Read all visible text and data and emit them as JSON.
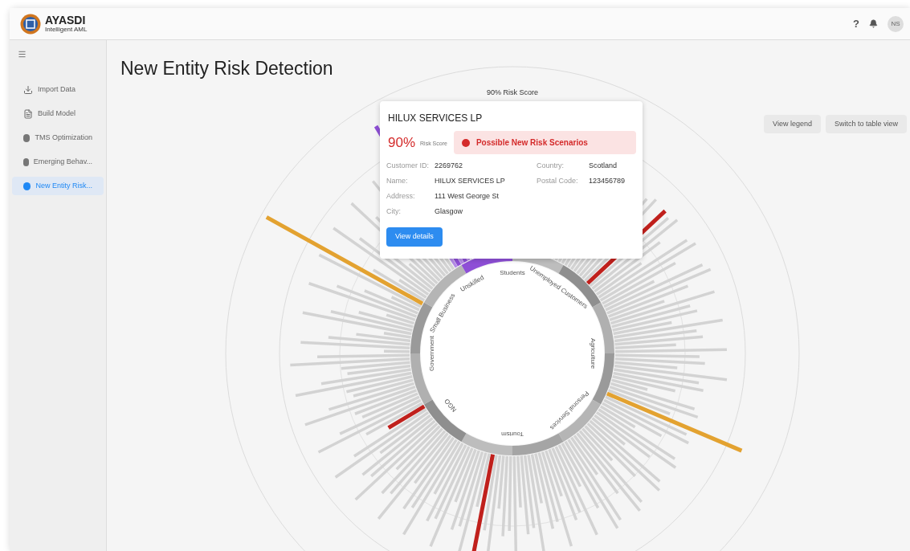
{
  "app": {
    "name": "AYASDI",
    "subtitle": "Intelligent AML"
  },
  "header": {
    "help": "?",
    "avatar": "NS"
  },
  "sidebar": {
    "items": [
      {
        "label": "Import Data",
        "kind": "download",
        "selected": false
      },
      {
        "label": "Build Model",
        "kind": "file",
        "selected": false
      },
      {
        "label": "TMS Optimization",
        "kind": "dot",
        "selected": false
      },
      {
        "label": "Emerging Behav...",
        "kind": "dot",
        "selected": false
      },
      {
        "label": "New Entity Risk...",
        "kind": "dot",
        "selected": true
      }
    ]
  },
  "page": {
    "title": "New Entity Risk Detection"
  },
  "actions": [
    "View legend",
    "Switch to table view"
  ],
  "chart": {
    "score_label": "90% Risk Score",
    "segments": [
      {
        "label": "Students"
      },
      {
        "label": "Unemployed Customers"
      },
      {
        "label": "Agriculture"
      },
      {
        "label": "Personal Services"
      },
      {
        "label": "Tourism"
      },
      {
        "label": "NGO"
      },
      {
        "label": "Government"
      },
      {
        "label": "Small Business"
      },
      {
        "label": "Unskilled"
      }
    ]
  },
  "popup": {
    "title": "HILUX SERVICES LP",
    "score": "90%",
    "score_label": "Risk Score",
    "alert": "Possible New Risk Scenarios",
    "fields_left": [
      {
        "label": "Customer ID:",
        "value": "2269762"
      },
      {
        "label": "Name:",
        "value": "HILUX SERVICES LP"
      },
      {
        "label": "Address:",
        "value": "111 West George St"
      },
      {
        "label": "City:",
        "value": "Glasgow"
      }
    ],
    "fields_right": [
      {
        "label": "Country:",
        "value": "Scotland"
      },
      {
        "label": "Postal Code:",
        "value": "123456789"
      }
    ],
    "button": "View details"
  }
}
